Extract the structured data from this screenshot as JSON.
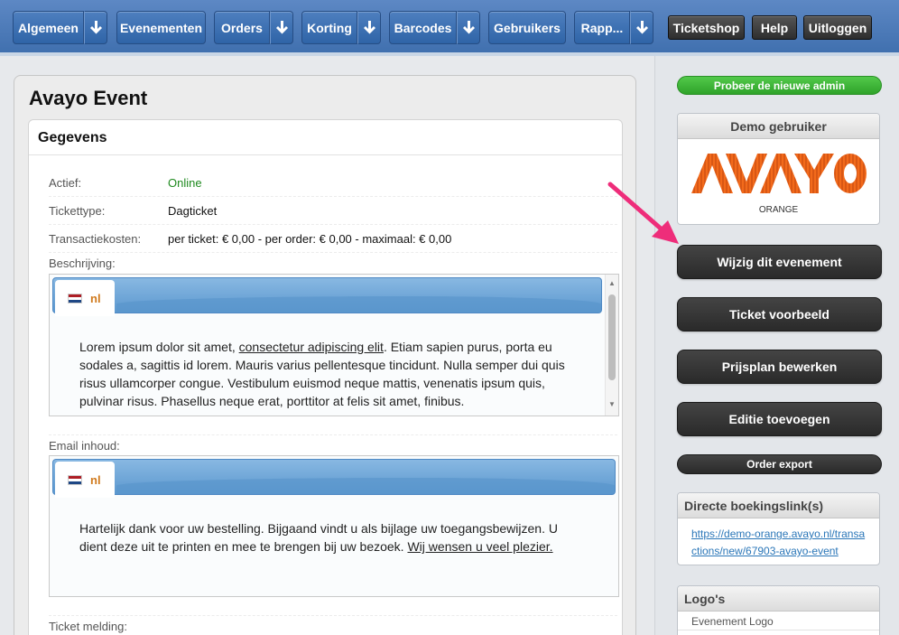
{
  "nav": {
    "items": [
      {
        "label": "Algemeen",
        "has_dropdown": true
      },
      {
        "label": "Evenementen",
        "has_dropdown": false
      },
      {
        "label": "Orders",
        "has_dropdown": true
      },
      {
        "label": "Korting",
        "has_dropdown": true
      },
      {
        "label": "Barcodes",
        "has_dropdown": true
      },
      {
        "label": "Gebruikers",
        "has_dropdown": false
      },
      {
        "label": "Rapp...",
        "has_dropdown": true
      }
    ],
    "dropdown_icon": "arrow-down-icon",
    "right_buttons": {
      "ticketshop": "Ticketshop",
      "help": "Help",
      "logout": "Uitloggen"
    }
  },
  "main": {
    "title": "Avayo Event",
    "section_title": "Gegevens",
    "fields": {
      "active": {
        "label": "Actief:",
        "value": "Online"
      },
      "ticket_type": {
        "label": "Tickettype:",
        "value": "Dagticket"
      },
      "transaction_costs": {
        "label": "Transactiekosten:",
        "value": "per ticket: € 0,00 - per order: € 0,00 - maximaal: € 0,00"
      }
    },
    "description": {
      "label": "Beschrijving:",
      "lang_code": "nl",
      "text_before": "Lorem ipsum dolor sit amet, ",
      "text_link": "consectetur adipiscing elit",
      "text_after": ". Etiam sapien purus, porta eu sodales a, sagittis id lorem. Mauris varius pellentesque tincidunt. Nulla semper dui quis risus ullamcorper congue. Vestibulum euismod neque mattis, venenatis ipsum quis, pulvinar risus. Phasellus neque erat, porttitor at felis sit amet, finibus."
    },
    "email": {
      "label": "Email inhoud:",
      "lang_code": "nl",
      "text_before": "Hartelijk dank voor uw bestelling. Bijgaand vindt u als bijlage uw toegangsbewijzen. U dient deze uit te printen en mee te brengen bij uw bezoek. ",
      "text_link": "Wij wensen u veel plezier."
    },
    "ticket_notice_label": "Ticket melding:"
  },
  "sidebar": {
    "try_new_admin": "Probeer de nieuwe admin",
    "demo_user": {
      "title": "Demo gebruiker",
      "logo_text": "AVAYO",
      "logo_subtitle": "ORANGE"
    },
    "buttons": {
      "edit_event": "Wijzig dit evenement",
      "ticket_preview": "Ticket voorbeeld",
      "edit_price_plan": "Prijsplan bewerken",
      "add_edition": "Editie toevoegen",
      "order_export": "Order export"
    },
    "booking": {
      "title": "Directe boekingslink(s)",
      "url": "https://demo-orange.avayo.nl/transactions/new/67903-avayo-event"
    },
    "logos": {
      "title": "Logo's",
      "items": [
        "Evenement Logo"
      ]
    }
  },
  "colors": {
    "nav_blue": "#3f6fae",
    "green": "#2fa32a",
    "online": "#1f8a1f",
    "link": "#2a76b8",
    "logo_orange": "#f26a1b",
    "pointer": "#ee2d7a"
  }
}
